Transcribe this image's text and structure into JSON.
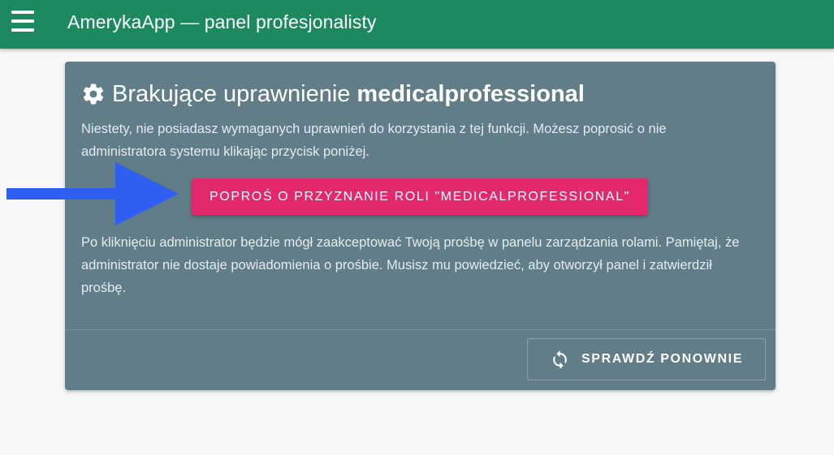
{
  "header": {
    "title": "AmerykaApp — panel profesjonalisty",
    "menu_icon": "hamburger-menu-icon"
  },
  "card": {
    "title_prefix": "Brakujące uprawnienie",
    "title_role": "medicalprofessional",
    "title_icon": "gear-icon",
    "intro_text": "Niestety, nie posiadasz wymaganych uprawnień do korzystania z tej funkcji. Możesz poprosić o nie administratora systemu klikając przycisk poniżej.",
    "request_button_label": "Poproś o przyznanie roli \"medicalprofessional\"",
    "info_text": "Po kliknięciu administrator będzie mógł zaakceptować Twoją prośbę w panelu zarządzania rolami. Pamiętaj, że administrator nie dostaje powiadomienia o prośbie. Musisz mu powiedzieć, aby otworzył panel i zatwierdził prośbę.",
    "check_again_label": "Sprawdź ponownie",
    "check_again_icon": "refresh-icon"
  },
  "annotation": {
    "arrow_icon": "arrow-right-icon",
    "arrow_color": "#2f5ff0"
  },
  "colors": {
    "header_bg": "#1c8a5e",
    "card_bg": "#607d88",
    "accent_button": "#e3296b",
    "page_bg": "#f7f7f7"
  }
}
